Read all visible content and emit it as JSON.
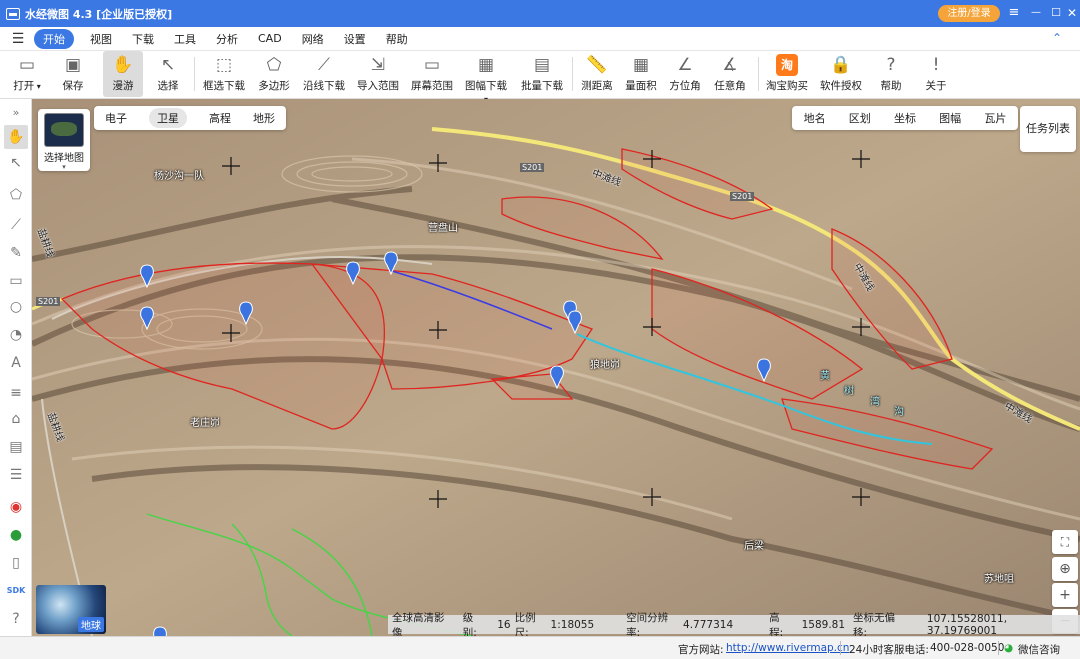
{
  "app": {
    "title": "水经微图 4.3 [企业版已授权]",
    "register_label": "注册/登录"
  },
  "window_controls": {
    "menu": "≡",
    "minimize": "—",
    "maximize": "☐",
    "close": "✕"
  },
  "menu": {
    "items": [
      "开始",
      "视图",
      "下载",
      "工具",
      "分析",
      "CAD",
      "网络",
      "设置",
      "帮助"
    ],
    "active": "开始"
  },
  "toolbar": {
    "items": [
      "打开",
      "保存",
      "漫游",
      "选择",
      "框选下载",
      "多边形",
      "沿线下载",
      "导入范围",
      "屏幕范围",
      "图幅下载",
      "批量下载",
      "测距离",
      "量面积",
      "方位角",
      "任意角",
      "淘宝购买",
      "软件授权",
      "帮助",
      "关于"
    ],
    "selected": "漫游",
    "taobao_glyph": "淘"
  },
  "map_controls": {
    "select_map_label": "选择地图",
    "map_types": [
      "电子",
      "卫星",
      "高程",
      "地形"
    ],
    "active_map_type": "卫星",
    "info_tabs": [
      "地名",
      "区划",
      "坐标",
      "图幅",
      "瓦片"
    ],
    "task_list": "任务列表",
    "earth_label": "地球"
  },
  "map_labels": {
    "places": [
      "杨沙沟一队",
      "营盘山",
      "狼地峁",
      "老庄峁",
      "后梁",
      "苏地咀"
    ],
    "roads": [
      "中滩线",
      "中滩线",
      "中滩线",
      "S201",
      "S201",
      "S201",
      "盐耕线",
      "盐耕线"
    ],
    "river": [
      "黄",
      "树",
      "湾",
      "沟"
    ]
  },
  "status": {
    "source": "全球高清影像",
    "level_label": "级别:",
    "level": "16",
    "scale_label": "比例尺:",
    "scale": "1:18055",
    "resolution_label": "空间分辨率:",
    "resolution": "4.777314",
    "elevation_label": "高程:",
    "elevation": "1589.81",
    "coords_label": "坐标无偏移:",
    "coords": "107.15528011, 37.19769001"
  },
  "footer": {
    "website_label": "官方网站:",
    "website": "http://www.rivermap.cn",
    "hotline_label": "24小时客服电话:",
    "hotline": "400-028-0050",
    "wechat": "微信咨询"
  },
  "colors": {
    "accent": "#3b78e3",
    "register": "#f5a43a",
    "boundary": "#e0241f",
    "river_cyan": "#2fc6e0",
    "route_blue": "#3a3ae6",
    "green_line": "#45d545"
  }
}
